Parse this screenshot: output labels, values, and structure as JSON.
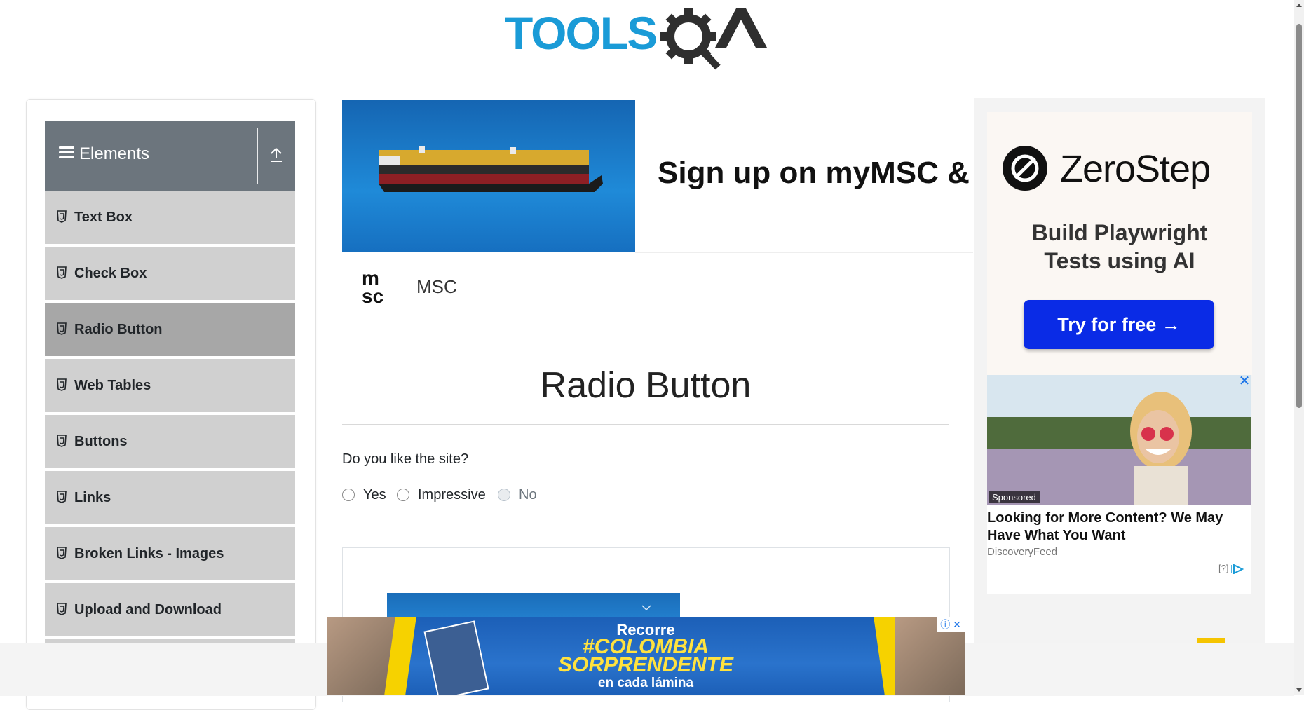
{
  "header": {
    "logo_text": "TOOLSQA"
  },
  "sidebar": {
    "group_title": "Elements",
    "items": [
      {
        "label": "Text Box"
      },
      {
        "label": "Check Box"
      },
      {
        "label": "Radio Button",
        "active": true
      },
      {
        "label": "Web Tables"
      },
      {
        "label": "Buttons"
      },
      {
        "label": "Links"
      },
      {
        "label": "Broken Links - Images"
      },
      {
        "label": "Upload and Download"
      }
    ]
  },
  "top_ad": {
    "headline": "Sign up on myMSC & B",
    "brand": "MSC"
  },
  "main": {
    "title": "Radio Button",
    "question": "Do you like the site?",
    "options": [
      {
        "label": "Yes",
        "disabled": false
      },
      {
        "label": "Impressive",
        "disabled": false
      },
      {
        "label": "No",
        "disabled": true
      }
    ]
  },
  "right_ad": {
    "brand": "ZeroStep",
    "tagline_line1": "Build Playwright",
    "tagline_line2": "Tests using AI",
    "cta": "Try for free →",
    "sponsored_badge": "Sponsored",
    "sponsored_headline": "Looking for More Content? We May Have What You Want",
    "sponsored_source": "DiscoveryFeed",
    "ad_choices": "[?]"
  },
  "bottom_ad": {
    "line1": "Recorre",
    "line2": "#COLOMBIA",
    "line3": "SORPRENDENTE",
    "line4": "en cada lámina"
  },
  "colors": {
    "sidebar_header": "#6c757d",
    "sidebar_item": "#d0d0d0",
    "sidebar_item_active": "#a7a7a7",
    "logo_blue": "#1a9bd7",
    "logo_dark": "#2f2f2f",
    "cta_blue": "#0a2be6"
  }
}
